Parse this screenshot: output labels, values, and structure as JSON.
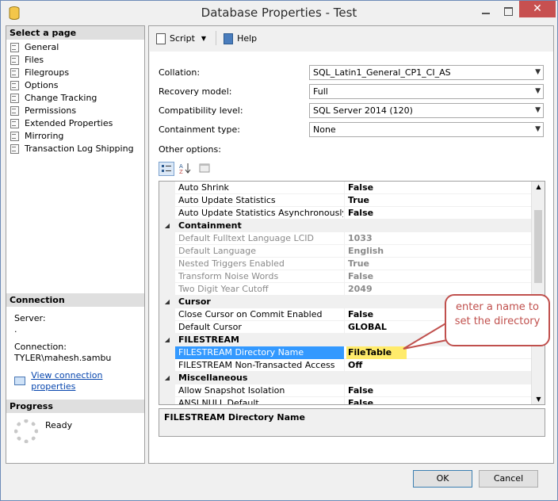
{
  "window": {
    "title": "Database Properties - Test",
    "close_glyph": "✕"
  },
  "left": {
    "select_header": "Select a page",
    "pages": [
      "General",
      "Files",
      "Filegroups",
      "Options",
      "Change Tracking",
      "Permissions",
      "Extended Properties",
      "Mirroring",
      "Transaction Log Shipping"
    ],
    "connection_header": "Connection",
    "server_label": "Server:",
    "server_value": ".",
    "connection_label": "Connection:",
    "connection_value": "TYLER\\mahesh.sambu",
    "view_link": "View connection properties",
    "progress_header": "Progress",
    "progress_status": "Ready"
  },
  "toolbar": {
    "script_label": "Script",
    "help_label": "Help"
  },
  "form": {
    "collation_label": "Collation:",
    "collation_value": "SQL_Latin1_General_CP1_CI_AS",
    "recovery_label": "Recovery model:",
    "recovery_value": "Full",
    "compat_label": "Compatibility level:",
    "compat_value": "SQL Server 2014 (120)",
    "containment_label": "Containment type:",
    "containment_value": "None",
    "other_options_label": "Other options:"
  },
  "grid": {
    "rows": [
      {
        "name": "Auto Shrink",
        "value": "False"
      },
      {
        "name": "Auto Update Statistics",
        "value": "True"
      },
      {
        "name": "Auto Update Statistics Asynchronously",
        "value": "False"
      },
      {
        "name": "Containment",
        "value": ""
      },
      {
        "name": "Default Fulltext Language LCID",
        "value": "1033"
      },
      {
        "name": "Default Language",
        "value": "English"
      },
      {
        "name": "Nested Triggers Enabled",
        "value": "True"
      },
      {
        "name": "Transform Noise Words",
        "value": "False"
      },
      {
        "name": "Two Digit Year Cutoff",
        "value": "2049"
      },
      {
        "name": "Cursor",
        "value": ""
      },
      {
        "name": "Close Cursor on Commit Enabled",
        "value": "False"
      },
      {
        "name": "Default Cursor",
        "value": "GLOBAL"
      },
      {
        "name": "FILESTREAM",
        "value": ""
      },
      {
        "name": "FILESTREAM Directory Name",
        "value": "FileTable"
      },
      {
        "name": "FILESTREAM Non-Transacted Access",
        "value": "Off"
      },
      {
        "name": "Miscellaneous",
        "value": ""
      },
      {
        "name": "Allow Snapshot Isolation",
        "value": "False"
      },
      {
        "name": "ANSI NULL Default",
        "value": "False"
      }
    ],
    "description": "FILESTREAM Directory Name"
  },
  "buttons": {
    "ok": "OK",
    "cancel": "Cancel"
  },
  "callout": {
    "line1": "enter a name to",
    "line2": "set the directory"
  }
}
